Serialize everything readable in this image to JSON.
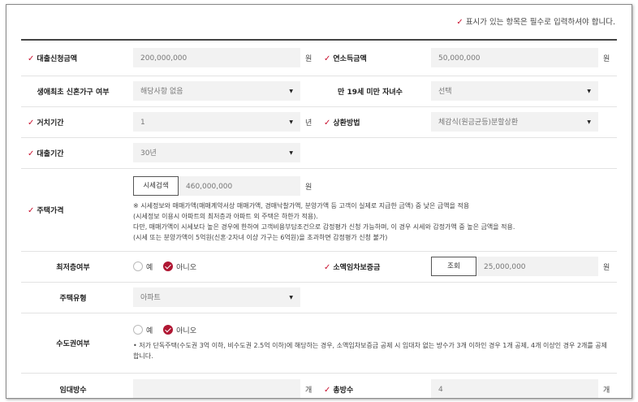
{
  "notice": "표시가 있는 항목은 필수로 입력하셔야 합니다.",
  "req_mark": "✓",
  "rows": {
    "loan_amount": {
      "label": "대출신청금액",
      "value": "200,000,000",
      "unit": "원"
    },
    "annual_income": {
      "label": "연소득금액",
      "value": "50,000,000",
      "unit": "원"
    },
    "first_home": {
      "label": "생애최초 신혼가구 여부",
      "value": "해당사항 없음"
    },
    "children": {
      "label": "만 19세 미만 자녀수",
      "value": "선택"
    },
    "grace_period": {
      "label": "거치기간",
      "value": "1",
      "unit": "년"
    },
    "repayment": {
      "label": "상환방법",
      "value": "체감식(원금균등)분할상환"
    },
    "loan_term": {
      "label": "대출기간",
      "value": "30년"
    },
    "house_price": {
      "label": "주택가격",
      "button": "시세검색",
      "value": "460,000,000",
      "unit": "원",
      "notes": [
        "※ 시세정보와 매매가액(매매계약서상 매매가액, 경매낙찰가액, 분양가액 등 고객이 실제로 지급한 금액) 중 낮은 금액을 적용",
        "(시세정보 이용시 아파트의 최저층과 아파트 외 주택은 하한가 적용).",
        "다만, 매매가액이 시세보다 높은 경우에 한하여 고객비용부담조건으로 감정평가 신청 가능하며, 이 경우 시세와 감정가액 중 높은 금액을 적용.",
        "(시세 또는 분양가액이 5억원(신혼·2자녀 이상 가구는 6억원)을 초과하면 감정평가 신청 불가)"
      ]
    },
    "lowest_floor": {
      "label": "최저층여부",
      "options": [
        "예",
        "아니오"
      ],
      "selected": "아니오"
    },
    "small_deposit": {
      "label": "소액임차보증금",
      "button": "조회",
      "value": "25,000,000",
      "unit": "원"
    },
    "house_type": {
      "label": "주택유형",
      "value": "아파트"
    },
    "capital_area": {
      "label": "수도권여부",
      "options": [
        "예",
        "아니오"
      ],
      "selected": "아니오",
      "note": "• 저가 단독주택(수도권 3억 이하, 비수도권 2.5억 이하)에 해당하는 경우, 소액임차보증금 공제 시 임대차 없는 방수가 3개 이하인 경우 1개 공제, 4개 이상인 경우 2개를 공제합니다."
    },
    "rented_rooms": {
      "label": "임대방수",
      "value": "",
      "unit": "개"
    },
    "total_rooms": {
      "label": "총방수",
      "value": "4",
      "unit": "개"
    }
  }
}
